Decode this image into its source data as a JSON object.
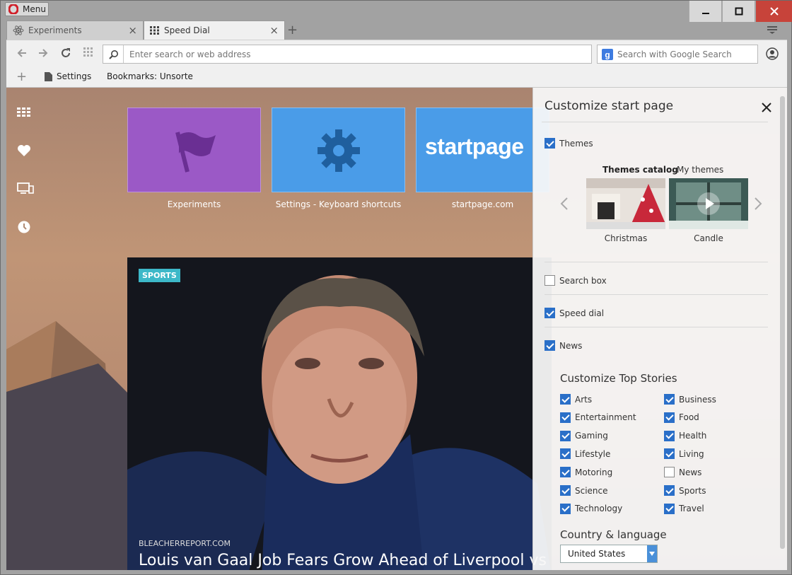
{
  "window": {
    "menu_label": "Menu",
    "minimize": "minimize",
    "maximize": "maximize",
    "close": "close"
  },
  "tabs": [
    {
      "label": "Experiments",
      "icon": "atom-icon"
    },
    {
      "label": "Speed Dial",
      "icon": "grid-icon"
    }
  ],
  "toolbar": {
    "address_placeholder": "Enter search or web address",
    "search_placeholder": "Search with Google Search"
  },
  "bookmarks": [
    {
      "label": "Settings"
    },
    {
      "label": "Bookmarks: Unsorted"
    }
  ],
  "speed_dial": [
    {
      "label": "Experiments",
      "color": "#9b59c6",
      "icon": "flag-icon"
    },
    {
      "label": "Settings - Keyboard shortcuts",
      "color": "#4a9ce8",
      "icon": "gear-icon"
    },
    {
      "label": "startpage.com",
      "color": "#4a9ce8",
      "icon": "startpage-logo",
      "logo_text": "startpage"
    }
  ],
  "news": {
    "category": "SPORTS",
    "source": "BLEACHERREPORT.COM",
    "headline": "Louis van Gaal Job Fears Grow Ahead of Liverpool vs"
  },
  "panel": {
    "title": "Customize start page",
    "themes_label": "Themes",
    "themes_checked": true,
    "themes_catalog_label": "Themes catalog",
    "my_themes_label": "My themes",
    "themes": [
      {
        "name": "Christmas"
      },
      {
        "name": "Candle"
      }
    ],
    "search_box_label": "Search box",
    "search_box_checked": false,
    "speed_dial_label": "Speed dial",
    "speed_dial_checked": true,
    "news_label": "News",
    "news_checked": true,
    "top_stories_title": "Customize Top Stories",
    "stories_left": [
      {
        "label": "Arts",
        "checked": true
      },
      {
        "label": "Entertainment",
        "checked": true
      },
      {
        "label": "Gaming",
        "checked": true
      },
      {
        "label": "Lifestyle",
        "checked": true
      },
      {
        "label": "Motoring",
        "checked": true
      },
      {
        "label": "Science",
        "checked": true
      },
      {
        "label": "Technology",
        "checked": true
      }
    ],
    "stories_right": [
      {
        "label": "Business",
        "checked": true
      },
      {
        "label": "Food",
        "checked": true
      },
      {
        "label": "Health",
        "checked": true
      },
      {
        "label": "Living",
        "checked": true
      },
      {
        "label": "News",
        "checked": false
      },
      {
        "label": "Sports",
        "checked": true
      },
      {
        "label": "Travel",
        "checked": true
      }
    ],
    "country_title": "Country & language",
    "country_value": "United States"
  }
}
